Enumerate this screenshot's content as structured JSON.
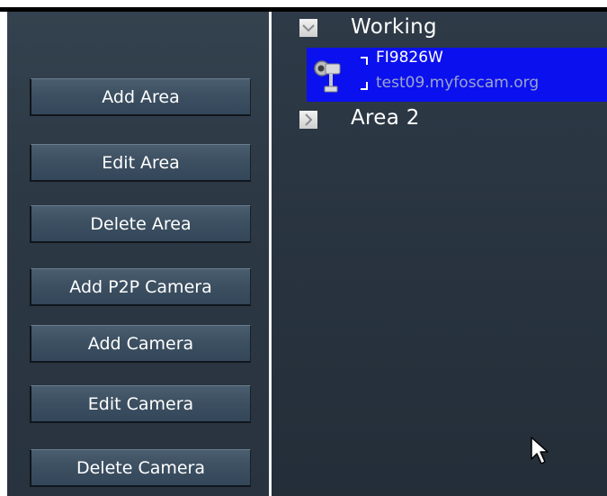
{
  "buttons": {
    "add_area": "Add Area",
    "edit_area": "Edit Area",
    "delete_area": "Delete Area",
    "add_p2p_camera": "Add P2P Camera",
    "add_camera": "Add Camera",
    "edit_camera": "Edit Camera",
    "delete_camera": "Delete Camera"
  },
  "tree": {
    "groups": [
      {
        "label": "Working",
        "expanded": true,
        "cameras": [
          {
            "name": "FI9826W",
            "host": "test09.myfoscam.org",
            "selected": true
          }
        ]
      },
      {
        "label": "Area 2",
        "expanded": false,
        "cameras": []
      }
    ]
  },
  "icons": {
    "expanded": "chevron-down-icon",
    "collapsed": "chevron-right-icon",
    "camera": "camera-icon",
    "cursor": "mouse-cursor-icon"
  },
  "colors": {
    "selection": "#0b10ef",
    "panel": "#2b3743",
    "button": "#3d5062"
  }
}
